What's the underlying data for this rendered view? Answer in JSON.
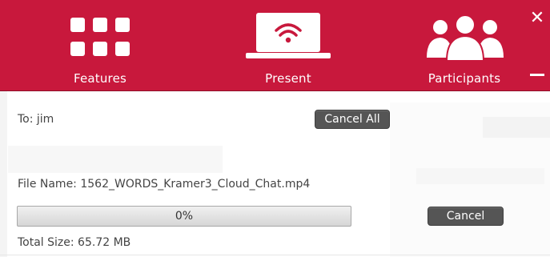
{
  "header": {
    "background_color": "#c8183c",
    "nav": [
      {
        "label": "Features",
        "icon": "grid-icon"
      },
      {
        "label": "Present",
        "icon": "laptop-wifi-icon"
      },
      {
        "label": "Participants",
        "icon": "people-icon"
      }
    ],
    "close_glyph": "✕",
    "minimize_glyph": "—"
  },
  "transfer": {
    "to_text": "To: jim",
    "cancel_all_label": "Cancel All",
    "file_name_text": "File Name: 1562_WORDS_Kramer3_Cloud_Chat.mp4",
    "progress_value": 0,
    "progress_text": "0%",
    "total_size_text": "Total Size: 65.72 MB",
    "cancel_label": "Cancel"
  }
}
